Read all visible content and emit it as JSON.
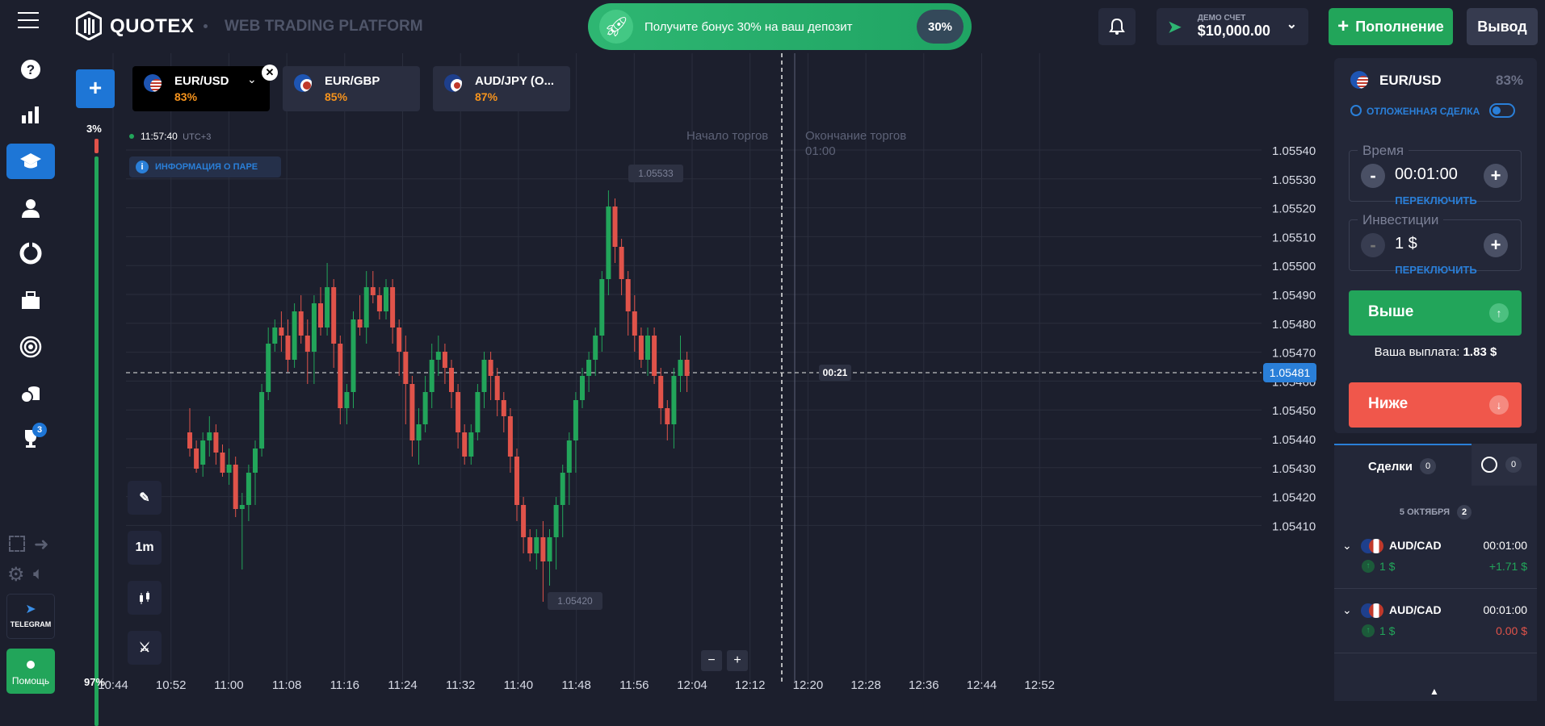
{
  "app": {
    "logo": "QUOTEX",
    "subtitle": "WEB TRADING PLATFORM"
  },
  "bonus": {
    "text": "Получите бонус 30% на ваш депозит",
    "percent": "30%"
  },
  "account": {
    "type": "ДЕМО СЧЕТ",
    "balance": "$10,000.00"
  },
  "buttons": {
    "deposit": "Пополнение",
    "withdraw": "Вывод"
  },
  "sidebar": {
    "telegram": "TELEGRAM",
    "help": "Помощь",
    "trophy_badge": "3"
  },
  "pair_tabs": [
    {
      "name": "EUR/USD",
      "payout": "83%"
    },
    {
      "name": "EUR/GBP",
      "payout": "85%"
    },
    {
      "name": "AUD/JPY (O...",
      "payout": "87%"
    }
  ],
  "chart": {
    "clock": "11:57:40",
    "timezone": "UTC+3",
    "pair_info": "ИНФОРМАЦИЯ О ПАРЕ",
    "sentiment_top": "3%",
    "sentiment_bottom": "97%",
    "start_trading": "Начало торгов",
    "end_trading": "Окончание торгов",
    "end_time": "01:00",
    "timer": "00:21",
    "high_label": "1.05533",
    "low_label": "1.05420",
    "current_price": "1.05481",
    "interval": "1m",
    "zoom_out": "−",
    "zoom_in": "+"
  },
  "chart_data": {
    "type": "candlestick",
    "y_ticks": [
      "1.05540",
      "1.05530",
      "1.05520",
      "1.05510",
      "1.05500",
      "1.05490",
      "1.05480",
      "1.05470",
      "1.05460",
      "1.05450",
      "1.05440",
      "1.05430",
      "1.05420",
      "1.05410"
    ],
    "x_ticks": [
      "10:44",
      "10:52",
      "11:00",
      "11:08",
      "11:16",
      "11:24",
      "11:32",
      "11:40",
      "11:48",
      "11:56",
      "12:04",
      "12:12",
      "12:20",
      "12:28",
      "12:36",
      "12:44",
      "12:52"
    ],
    "colors": {
      "up": "#22a55a",
      "down": "#e0534a"
    }
  },
  "trade_panel": {
    "pair": "EUR/USD",
    "payout": "83%",
    "pending_label": "ОТЛОЖЕННАЯ СДЕЛКА",
    "time_label": "Время",
    "time_value": "00:01:00",
    "switch": "ПЕРЕКЛЮЧИТЬ",
    "investment_label": "Инвестиции",
    "investment_value": "1 $",
    "up": "Выше",
    "down": "Ниже",
    "payout_text": "Ваша выплата:",
    "payout_value": "1.83 $",
    "minus": "-",
    "plus": "+"
  },
  "deals": {
    "tab_label": "Сделки",
    "tab_count": "0",
    "history_count": "0",
    "date": "5 ОКТЯБРЯ",
    "date_count": "2",
    "rows": [
      {
        "pair": "AUD/CAD",
        "duration": "00:01:00",
        "amount": "1 $",
        "result": "+1.71 $",
        "result_color": "#22a55a"
      },
      {
        "pair": "AUD/CAD",
        "duration": "00:01:00",
        "amount": "1 $",
        "result": "0.00 $",
        "result_color": "#e0534a"
      }
    ]
  }
}
